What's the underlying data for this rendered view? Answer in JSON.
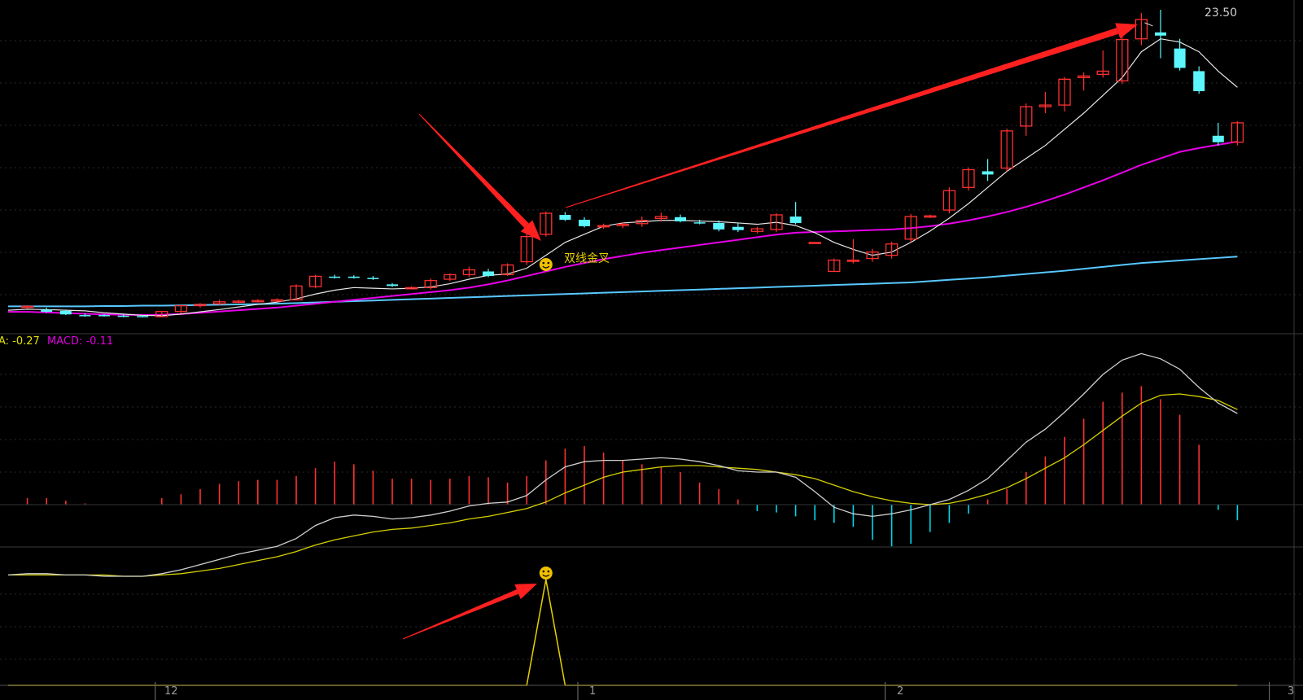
{
  "price_panel": {
    "high_label": "23.50",
    "signal_text": "双线金叉",
    "signal_icon": "smiley-icon"
  },
  "macd_panel": {
    "dea_label": "A: -0.27",
    "macd_label": "MACD: -0.11",
    "colors": {
      "dif": "#cfcfcf",
      "dea": "#d4d000",
      "hist_up": "#ff3030",
      "hist_down": "#00d8e8"
    }
  },
  "signal_panel": {
    "signal_icon": "smiley-icon",
    "colors": {
      "line": "#e8d000"
    }
  },
  "x_axis": {
    "ticks": [
      "12",
      "1",
      "2",
      "3"
    ]
  },
  "colors": {
    "background": "#000000",
    "up_candle": "#ff3030",
    "down_candle": "#5cf6ff",
    "ma5": "#e6e6e6",
    "ma_mid": "#e800e8",
    "ma_long": "#58c8ff",
    "arrow": "#ff2020",
    "smiley": "#f0c000",
    "grid": "#2a2a2a"
  },
  "chart_data": {
    "type": "candlestick",
    "ohlc": [
      [
        0,
        0,
        0,
        0
      ],
      [
        14.7,
        14.75,
        14.65,
        14.72
      ],
      [
        14.62,
        14.68,
        14.52,
        14.55
      ],
      [
        14.58,
        14.62,
        14.45,
        14.47
      ],
      [
        14.45,
        14.5,
        14.4,
        14.43
      ],
      [
        14.45,
        14.48,
        14.4,
        14.42
      ],
      [
        14.43,
        14.46,
        14.38,
        14.41
      ],
      [
        14.42,
        14.45,
        14.38,
        14.4
      ],
      [
        14.4,
        14.58,
        14.38,
        14.56
      ],
      [
        14.56,
        14.76,
        14.5,
        14.74
      ],
      [
        14.74,
        14.82,
        14.68,
        14.78
      ],
      [
        14.8,
        14.92,
        14.76,
        14.86
      ],
      [
        14.86,
        14.92,
        14.82,
        14.88
      ],
      [
        14.88,
        14.94,
        14.84,
        14.9
      ],
      [
        14.9,
        14.97,
        14.86,
        14.92
      ],
      [
        14.92,
        15.4,
        14.9,
        15.35
      ],
      [
        15.33,
        15.7,
        15.28,
        15.65
      ],
      [
        15.64,
        15.7,
        15.58,
        15.62
      ],
      [
        15.64,
        15.68,
        15.58,
        15.6
      ],
      [
        15.6,
        15.66,
        15.54,
        15.58
      ],
      [
        15.4,
        15.44,
        15.32,
        15.35
      ],
      [
        15.28,
        15.34,
        15.24,
        15.3
      ],
      [
        15.3,
        15.58,
        15.24,
        15.52
      ],
      [
        15.56,
        15.74,
        15.5,
        15.7
      ],
      [
        15.7,
        15.95,
        15.62,
        15.85
      ],
      [
        15.8,
        15.88,
        15.62,
        15.66
      ],
      [
        15.7,
        16.05,
        15.66,
        16.0
      ],
      [
        16.1,
        16.98,
        16.0,
        16.88
      ],
      [
        16.95,
        17.66,
        16.88,
        17.6
      ],
      [
        17.55,
        17.64,
        17.36,
        17.4
      ],
      [
        17.4,
        17.48,
        17.16,
        17.2
      ],
      [
        17.18,
        17.28,
        17.12,
        17.22
      ],
      [
        17.22,
        17.32,
        17.14,
        17.26
      ],
      [
        17.28,
        17.5,
        17.18,
        17.38
      ],
      [
        17.44,
        17.62,
        17.34,
        17.5
      ],
      [
        17.48,
        17.56,
        17.32,
        17.35
      ],
      [
        17.32,
        17.4,
        17.26,
        17.3
      ],
      [
        17.3,
        17.38,
        17.04,
        17.1
      ],
      [
        17.18,
        17.3,
        17.02,
        17.08
      ],
      [
        17.04,
        17.18,
        16.98,
        17.12
      ],
      [
        17.1,
        17.6,
        17.02,
        17.55
      ],
      [
        17.5,
        17.95,
        17.26,
        17.3
      ],
      [
        16.7,
        16.7,
        16.7,
        16.7
      ],
      [
        15.8,
        16.2,
        15.8,
        16.15
      ],
      [
        16.15,
        16.8,
        16.05,
        16.15
      ],
      [
        16.2,
        16.5,
        16.1,
        16.4
      ],
      [
        16.3,
        16.72,
        16.2,
        16.65
      ],
      [
        16.8,
        17.58,
        16.7,
        17.5
      ],
      [
        17.52,
        17.56,
        17.45,
        17.52
      ],
      [
        17.7,
        18.4,
        17.6,
        18.3
      ],
      [
        18.4,
        19.02,
        18.3,
        18.95
      ],
      [
        18.9,
        19.28,
        18.6,
        18.8
      ],
      [
        19.0,
        20.22,
        18.9,
        20.15
      ],
      [
        20.3,
        21.0,
        20.0,
        20.9
      ],
      [
        20.9,
        21.36,
        20.7,
        20.95
      ],
      [
        20.95,
        21.82,
        20.75,
        21.75
      ],
      [
        21.8,
        21.96,
        21.4,
        21.85
      ],
      [
        21.9,
        22.64,
        21.8,
        22.0
      ],
      [
        21.7,
        23.2,
        21.6,
        22.98
      ],
      [
        23.0,
        23.8,
        22.8,
        23.6
      ],
      [
        23.2,
        23.9,
        22.4,
        23.1
      ],
      [
        22.7,
        23.0,
        22.02,
        22.1
      ],
      [
        22.0,
        22.15,
        21.3,
        21.38
      ],
      [
        20.0,
        20.4,
        19.7,
        19.8
      ],
      [
        19.8,
        20.45,
        19.7,
        20.4
      ]
    ],
    "ma_short": [
      14.6,
      14.63,
      14.62,
      14.6,
      14.58,
      14.52,
      14.48,
      14.44,
      14.43,
      14.48,
      14.55,
      14.62,
      14.7,
      14.78,
      14.85,
      14.95,
      15.1,
      15.22,
      15.3,
      15.28,
      15.26,
      15.28,
      15.32,
      15.42,
      15.56,
      15.68,
      15.72,
      15.9,
      16.3,
      16.7,
      16.95,
      17.2,
      17.3,
      17.34,
      17.38,
      17.38,
      17.36,
      17.34,
      17.3,
      17.26,
      17.32,
      17.22,
      17.0,
      16.7,
      16.48,
      16.3,
      16.4,
      16.7,
      17.05,
      17.45,
      17.9,
      18.4,
      18.9,
      19.3,
      19.7,
      20.2,
      20.7,
      21.25,
      21.8,
      22.6,
      23.0,
      22.9,
      22.6,
      22.0,
      21.5
    ],
    "ma_mid": [
      14.55,
      14.55,
      14.53,
      14.51,
      14.49,
      14.47,
      14.46,
      14.45,
      14.46,
      14.48,
      14.52,
      14.56,
      14.6,
      14.64,
      14.68,
      14.74,
      14.8,
      14.86,
      14.92,
      14.98,
      15.04,
      15.1,
      15.16,
      15.22,
      15.3,
      15.4,
      15.52,
      15.66,
      15.8,
      15.94,
      16.06,
      16.18,
      16.28,
      16.38,
      16.46,
      16.54,
      16.62,
      16.7,
      16.78,
      16.86,
      16.94,
      17.0,
      17.02,
      17.04,
      17.06,
      17.08,
      17.1,
      17.14,
      17.2,
      17.28,
      17.38,
      17.5,
      17.64,
      17.8,
      17.98,
      18.18,
      18.4,
      18.62,
      18.86,
      19.1,
      19.3,
      19.5,
      19.62,
      19.72,
      19.82
    ],
    "ma_long": [
      14.72,
      14.72,
      14.72,
      14.72,
      14.72,
      14.73,
      14.73,
      14.74,
      14.74,
      14.75,
      14.76,
      14.77,
      14.78,
      14.79,
      14.8,
      14.82,
      14.84,
      14.86,
      14.88,
      14.9,
      14.92,
      14.94,
      14.96,
      14.98,
      15.0,
      15.02,
      15.04,
      15.06,
      15.08,
      15.1,
      15.12,
      15.14,
      15.16,
      15.18,
      15.2,
      15.22,
      15.24,
      15.26,
      15.28,
      15.3,
      15.32,
      15.34,
      15.36,
      15.38,
      15.4,
      15.42,
      15.44,
      15.46,
      15.5,
      15.54,
      15.58,
      15.62,
      15.67,
      15.72,
      15.77,
      15.82,
      15.88,
      15.94,
      16.0,
      16.06,
      16.1,
      16.14,
      16.18,
      16.22,
      16.26
    ],
    "macd_dif": [
      -0.54,
      -0.53,
      -0.53,
      -0.54,
      -0.54,
      -0.55,
      -0.55,
      -0.55,
      -0.53,
      -0.5,
      -0.46,
      -0.42,
      -0.38,
      -0.35,
      -0.32,
      -0.26,
      -0.16,
      -0.1,
      -0.08,
      -0.09,
      -0.11,
      -0.1,
      -0.08,
      -0.05,
      -0.01,
      0.01,
      0.02,
      0.07,
      0.19,
      0.29,
      0.33,
      0.34,
      0.34,
      0.35,
      0.36,
      0.35,
      0.33,
      0.3,
      0.26,
      0.25,
      0.25,
      0.21,
      0.1,
      -0.02,
      -0.07,
      -0.09,
      -0.07,
      -0.04,
      0.0,
      0.04,
      0.11,
      0.2,
      0.34,
      0.48,
      0.58,
      0.71,
      0.85,
      1.0,
      1.11,
      1.16,
      1.12,
      1.04,
      0.9,
      0.78,
      0.7
    ],
    "macd_dea": [
      -0.54,
      -0.54,
      -0.54,
      -0.54,
      -0.54,
      -0.54,
      -0.55,
      -0.55,
      -0.54,
      -0.53,
      -0.51,
      -0.49,
      -0.46,
      -0.43,
      -0.4,
      -0.36,
      -0.31,
      -0.27,
      -0.24,
      -0.21,
      -0.19,
      -0.18,
      -0.16,
      -0.14,
      -0.11,
      -0.09,
      -0.06,
      -0.03,
      0.02,
      0.09,
      0.15,
      0.21,
      0.25,
      0.27,
      0.29,
      0.3,
      0.3,
      0.29,
      0.28,
      0.27,
      0.25,
      0.23,
      0.2,
      0.15,
      0.1,
      0.06,
      0.03,
      0.01,
      0.0,
      0.01,
      0.04,
      0.08,
      0.13,
      0.2,
      0.28,
      0.36,
      0.46,
      0.57,
      0.68,
      0.78,
      0.84,
      0.85,
      0.83,
      0.8,
      0.73
    ],
    "macd_hist": [
      0.0,
      0.05,
      0.05,
      0.03,
      0.01,
      0.0,
      0.0,
      0.0,
      0.05,
      0.08,
      0.12,
      0.16,
      0.18,
      0.19,
      0.19,
      0.22,
      0.28,
      0.33,
      0.31,
      0.26,
      0.2,
      0.2,
      0.19,
      0.2,
      0.22,
      0.21,
      0.17,
      0.22,
      0.34,
      0.43,
      0.45,
      0.4,
      0.34,
      0.31,
      0.29,
      0.25,
      0.17,
      0.12,
      0.04,
      -0.05,
      -0.06,
      -0.09,
      -0.12,
      -0.14,
      -0.17,
      -0.27,
      -0.32,
      -0.3,
      -0.21,
      -0.14,
      -0.07,
      0.04,
      0.12,
      0.25,
      0.37,
      0.52,
      0.66,
      0.79,
      0.86,
      0.91,
      0.81,
      0.69,
      0.46,
      -0.04,
      -0.12
    ],
    "signal": [
      0,
      0,
      0,
      0,
      0,
      0,
      0,
      0,
      0,
      0,
      0,
      0,
      0,
      0,
      0,
      0,
      0,
      0,
      0,
      0,
      0,
      0,
      0,
      0,
      0,
      0,
      0,
      0,
      1,
      0,
      0,
      0,
      0,
      0,
      0,
      0,
      0,
      0,
      0,
      0,
      0,
      0,
      0,
      0,
      0,
      0,
      0,
      0,
      0,
      0,
      0,
      0,
      0,
      0,
      0,
      0,
      0,
      0,
      0,
      0,
      0,
      0,
      0,
      0,
      0
    ],
    "signal_index": 28,
    "high_value": 23.5,
    "x_tick_indices": {
      "12": 8,
      "1": 30,
      "2": 46,
      "3": 66
    }
  }
}
